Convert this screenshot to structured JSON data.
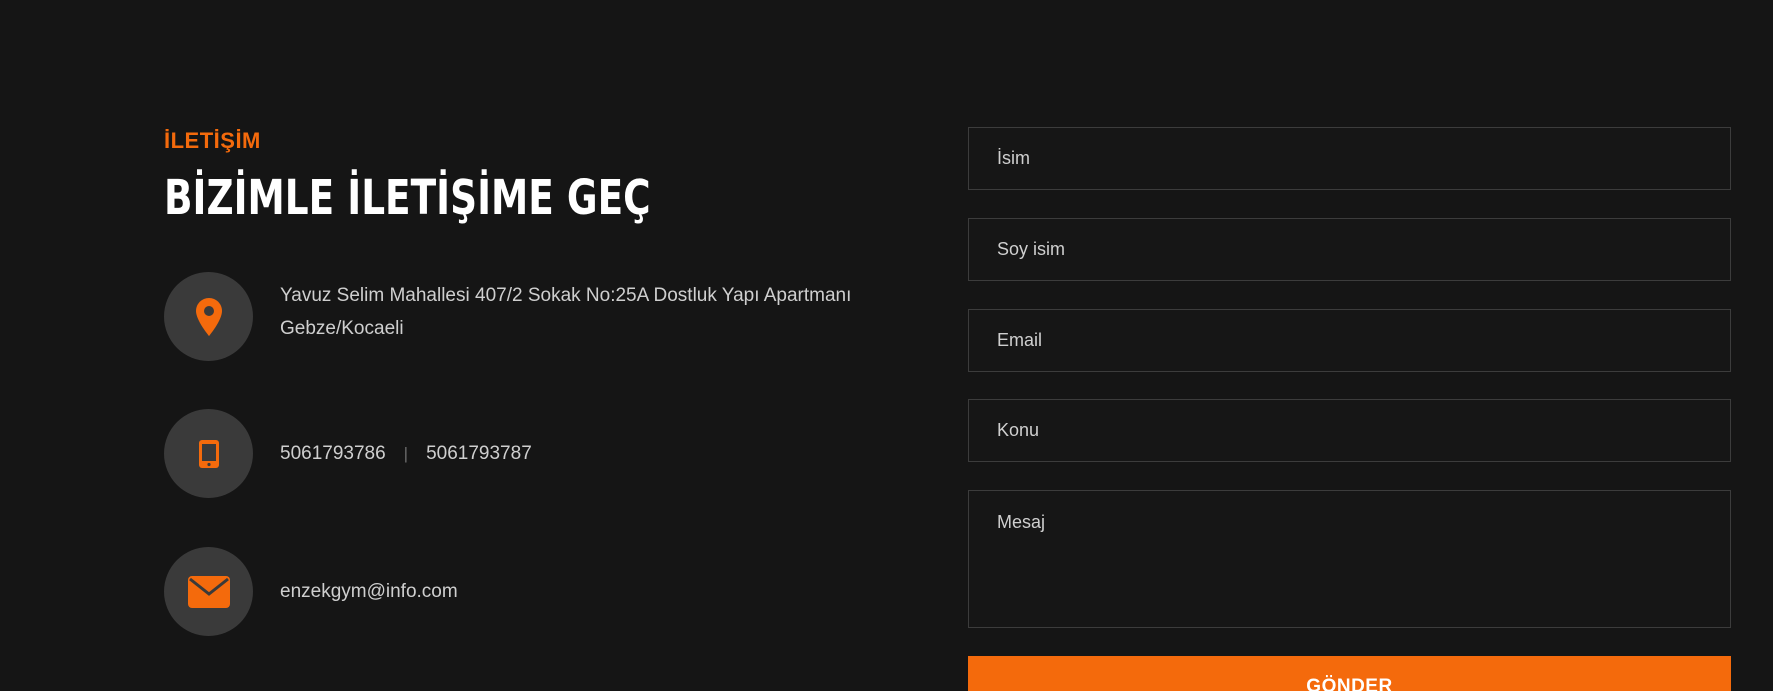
{
  "contact": {
    "eyebrow": "İLETİŞİM",
    "heading": "BİZİMLE İLETİŞİME GEÇ",
    "address": "Yavuz Selim Mahallesi 407/2 Sokak No:25A Dostluk Yapı Apartmanı Gebze/Kocaeli",
    "phone_1": "5061793786",
    "phone_separator": "|",
    "phone_2": "5061793787",
    "email": "enzekgym@info.com",
    "icons": {
      "address": "map-pin-icon",
      "phone": "mobile-phone-icon",
      "email": "envelope-icon"
    }
  },
  "form": {
    "first_name_placeholder": "İsim",
    "last_name_placeholder": "Soy isim",
    "email_placeholder": "Email",
    "subject_placeholder": "Konu",
    "message_placeholder": "Mesaj",
    "submit_label": "GÖNDER"
  },
  "colors": {
    "background": "#151515",
    "accent": "#f46a0c",
    "icon_circle": "#3a3a3a"
  }
}
